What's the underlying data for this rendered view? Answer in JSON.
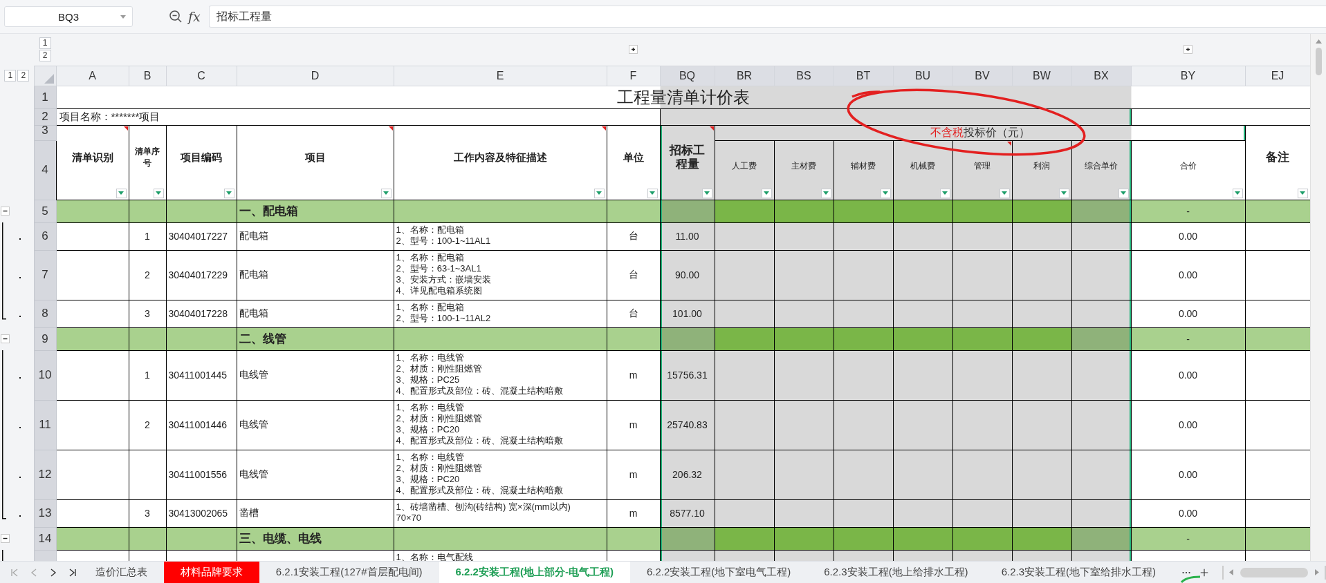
{
  "toolbar": {
    "name_box": "BQ3",
    "formula_label": "fx",
    "formula": "招标工程量"
  },
  "outline": {
    "column_levels": [
      "1",
      "2"
    ],
    "row_levels": [
      "1",
      "2"
    ]
  },
  "columns": [
    {
      "letter": "A",
      "selected": false
    },
    {
      "letter": "B",
      "selected": false
    },
    {
      "letter": "C",
      "selected": false
    },
    {
      "letter": "D",
      "selected": false
    },
    {
      "letter": "E",
      "selected": false
    },
    {
      "letter": "F",
      "selected": false
    },
    {
      "letter": "BQ",
      "selected": true
    },
    {
      "letter": "BR",
      "selected": true
    },
    {
      "letter": "BS",
      "selected": true
    },
    {
      "letter": "BT",
      "selected": true
    },
    {
      "letter": "BU",
      "selected": true
    },
    {
      "letter": "BV",
      "selected": true
    },
    {
      "letter": "BW",
      "selected": true
    },
    {
      "letter": "BX",
      "selected": true
    },
    {
      "letter": "BY",
      "selected": false
    },
    {
      "letter": "EJ",
      "selected": false
    }
  ],
  "header_row_numbers": [
    "1",
    "2",
    "3",
    "4"
  ],
  "title": "工程量清单计价表",
  "project_name": "项目名称：*******项目",
  "price_group_header": {
    "parts": [
      {
        "text": "不含税",
        "color": "#e31c1c"
      },
      {
        "text": "投标价（元）",
        "color": "#333333"
      }
    ]
  },
  "headers": [
    {
      "text": "清单识别",
      "kind": "main",
      "comment": true
    },
    {
      "text": "清单序号",
      "kind": "small",
      "comment": false
    },
    {
      "text": "项目编码",
      "kind": "main",
      "comment": false
    },
    {
      "text": "项目",
      "kind": "main",
      "comment": true
    },
    {
      "text": "工作内容及特征描述",
      "kind": "main",
      "comment": true
    },
    {
      "text": "单位",
      "kind": "main",
      "comment": false
    },
    {
      "text": "招标工程量",
      "kind": "large",
      "comment": true
    },
    {
      "text": "人工费",
      "kind": "sub",
      "comment": false
    },
    {
      "text": "主材费",
      "kind": "sub",
      "comment": false
    },
    {
      "text": "辅材费",
      "kind": "sub",
      "comment": false
    },
    {
      "text": "机械费",
      "kind": "sub",
      "comment": false
    },
    {
      "text": "管理",
      "kind": "sub",
      "comment": true
    },
    {
      "text": "利润",
      "kind": "sub",
      "comment": false
    },
    {
      "text": "综合单价",
      "kind": "sub",
      "comment": false
    },
    {
      "text": "合价",
      "kind": "sub",
      "comment": false
    },
    {
      "text": "备注",
      "kind": "large",
      "comment": false
    }
  ],
  "rows": [
    {
      "number": "5",
      "kind": "section",
      "expanded": true,
      "title": "一、配电箱",
      "total": "-"
    },
    {
      "number": "6",
      "kind": "item",
      "seq": "1",
      "code": "30404017227",
      "name": "配电箱",
      "description": [
        "1、名称：配电箱",
        "2、型号：100-1~11AL1"
      ],
      "unit": "台",
      "quantity": "11.00",
      "total": "0.00"
    },
    {
      "number": "7",
      "kind": "item",
      "seq": "2",
      "code": "30404017229",
      "name": "配电箱",
      "description": [
        "1、名称：配电箱",
        "2、型号：63-1~3AL1",
        "3、安装方式：嵌墙安装",
        "4、详见配电箱系统图"
      ],
      "unit": "台",
      "quantity": "90.00",
      "total": "0.00"
    },
    {
      "number": "8",
      "kind": "item",
      "seq": "3",
      "code": "30404017228",
      "name": "配电箱",
      "description": [
        "1、名称：配电箱",
        "2、型号：100-1~11AL2"
      ],
      "unit": "台",
      "quantity": "101.00",
      "total": "0.00"
    },
    {
      "number": "9",
      "kind": "section",
      "expanded": true,
      "title": "二、线管",
      "total": "-"
    },
    {
      "number": "10",
      "kind": "item",
      "seq": "1",
      "code": "30411001445",
      "name": "电线管",
      "description": [
        "1、名称：电线管",
        "2、材质：刚性阻燃管",
        "3、规格：PC25",
        "4、配置形式及部位：砖、混凝土结构暗敷"
      ],
      "unit": "m",
      "quantity": "15756.31",
      "total": "0.00"
    },
    {
      "number": "11",
      "kind": "item",
      "seq": "2",
      "code": "30411001446",
      "name": "电线管",
      "description": [
        "1、名称：电线管",
        "2、材质：刚性阻燃管",
        "3、规格：PC20",
        "4、配置形式及部位：砖、混凝土结构暗敷"
      ],
      "unit": "m",
      "quantity": "25740.83",
      "total": "0.00"
    },
    {
      "number": "12",
      "kind": "item",
      "code": "30411001556",
      "name": "电线管",
      "description": [
        "1、名称：电线管",
        "2、材质：刚性阻燃管",
        "3、规格：PC20",
        "4、配置形式及部位：砖、混凝土结构暗敷"
      ],
      "unit": "m",
      "quantity": "206.32",
      "total": "0.00"
    },
    {
      "number": "13",
      "kind": "item",
      "seq": "3",
      "code": "30413002065",
      "name": "凿槽",
      "description": [
        "1、砖墙凿槽、刨沟(砖结构) 宽×深(mm以内)",
        "70×70"
      ],
      "unit": "m",
      "quantity": "8577.10",
      "total": "0.00"
    },
    {
      "number": "14",
      "kind": "section",
      "expanded": true,
      "title": "三、电缆、电线",
      "total": "-"
    },
    {
      "kind": "item",
      "description": [
        "1、名称：电气配线"
      ]
    }
  ],
  "tabs": [
    {
      "label": "造价汇总表",
      "selected": false
    },
    {
      "label": "材料品牌要求",
      "selected": false,
      "color": "#ff0000"
    },
    {
      "label": "6.2.1安装工程(127#首层配电间)",
      "selected": false
    },
    {
      "label": "6.2.2安装工程(地上部分-电气工程)",
      "selected": true
    },
    {
      "label": "6.2.2安装工程(地下室电气工程)",
      "selected": false
    },
    {
      "label": "6.2.3安装工程(地上给排水工程)",
      "selected": false
    },
    {
      "label": "6.2.3安装工程(地下室给排水工程)",
      "selected": false
    }
  ]
}
